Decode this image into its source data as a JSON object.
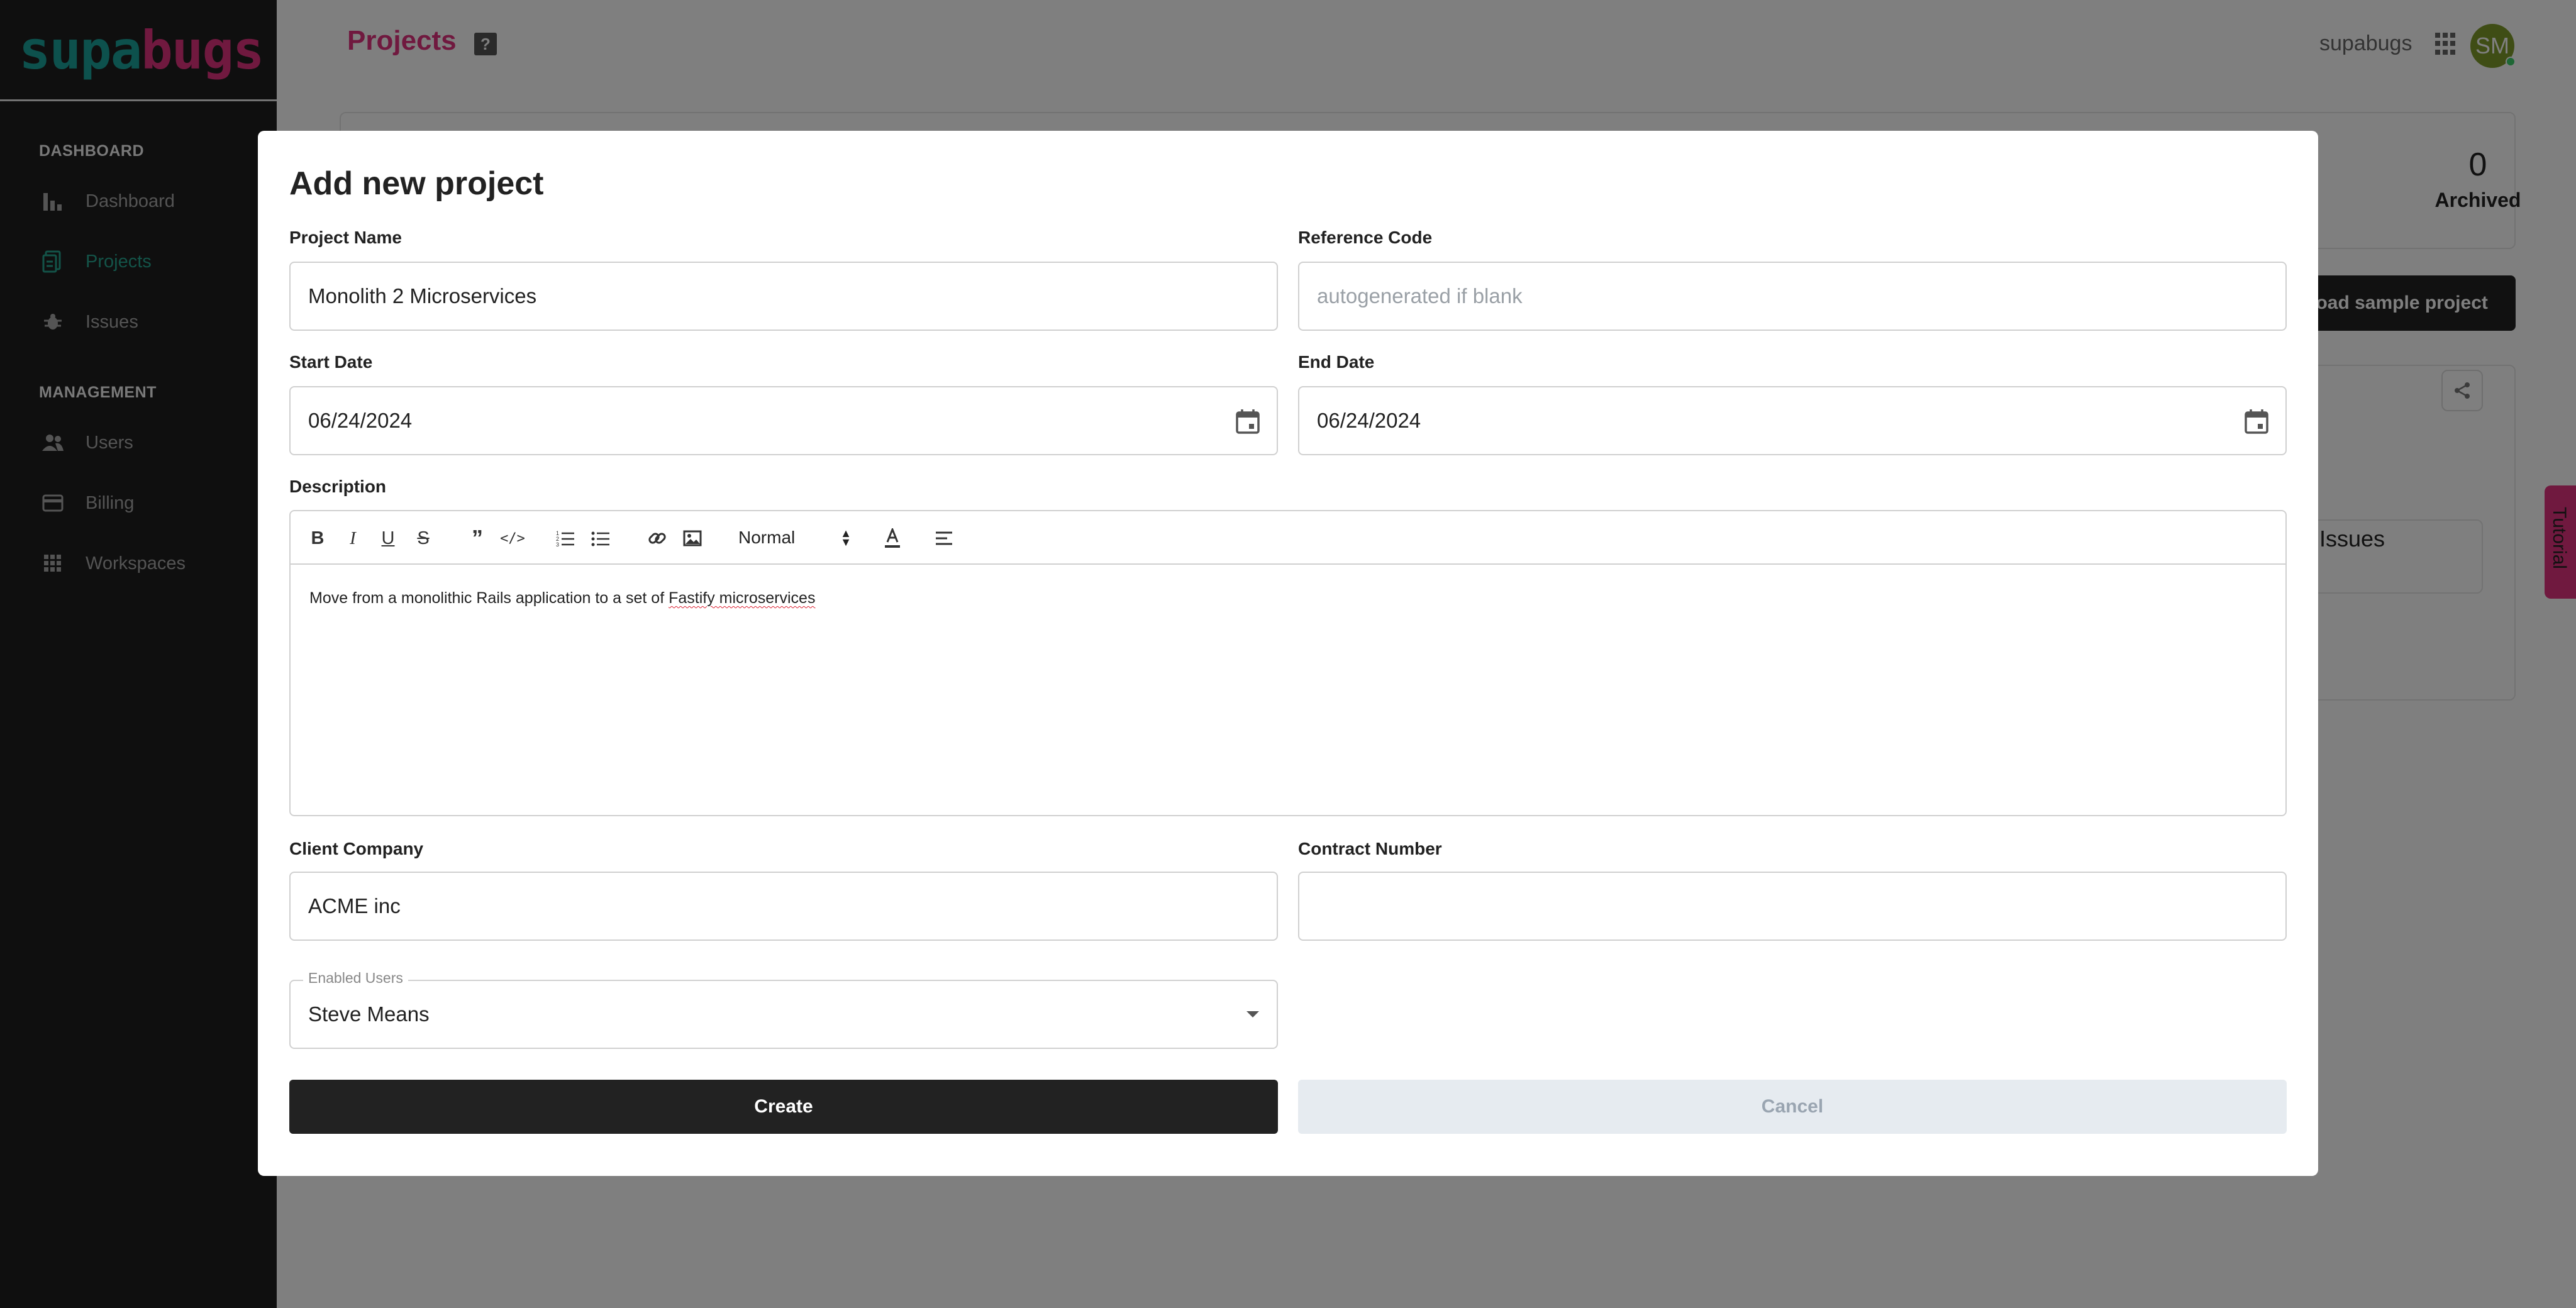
{
  "sidebar": {
    "logo_part1": "supa",
    "logo_part2": "bugs",
    "sections": [
      {
        "label": "DASHBOARD",
        "items": [
          {
            "label": "Dashboard",
            "icon": "bar-chart-icon"
          },
          {
            "label": "Projects",
            "icon": "document-icon",
            "active": true
          },
          {
            "label": "Issues",
            "icon": "bug-icon"
          }
        ]
      },
      {
        "label": "MANAGEMENT",
        "items": [
          {
            "label": "Users",
            "icon": "users-icon"
          },
          {
            "label": "Billing",
            "icon": "credit-card-icon"
          },
          {
            "label": "Workspaces",
            "icon": "grid-icon"
          }
        ]
      }
    ]
  },
  "header": {
    "title": "Projects",
    "help": "?",
    "workspace": "supabugs",
    "avatar_initials": "SM"
  },
  "background": {
    "archived_count": "0",
    "archived_label": "Archived",
    "sample_button": "Load sample project",
    "issues_label": "Issues",
    "tutorial_tab": "Tutorial"
  },
  "modal": {
    "title": "Add new project",
    "project_name": {
      "label": "Project Name",
      "value": "Monolith 2 Microservices"
    },
    "reference_code": {
      "label": "Reference Code",
      "value": "",
      "placeholder": "autogenerated if blank"
    },
    "start_date": {
      "label": "Start Date",
      "value": "06/24/2024"
    },
    "end_date": {
      "label": "End Date",
      "value": "06/24/2024"
    },
    "description": {
      "label": "Description",
      "format": "Normal",
      "text_prefix": "Move from a monolithic Rails application to a set of ",
      "text_misspelled": "Fastify microservices"
    },
    "client_company": {
      "label": "Client Company",
      "value": "ACME inc"
    },
    "contract_number": {
      "label": "Contract Number",
      "value": ""
    },
    "enabled_users": {
      "label": "Enabled Users",
      "value": "Steve Means"
    },
    "create_label": "Create",
    "cancel_label": "Cancel"
  },
  "colors": {
    "brand_teal": "#1aa39a",
    "brand_pink": "#e0337f",
    "active_nav": "#27a690",
    "sidebar_bg": "#1f1f1f"
  }
}
